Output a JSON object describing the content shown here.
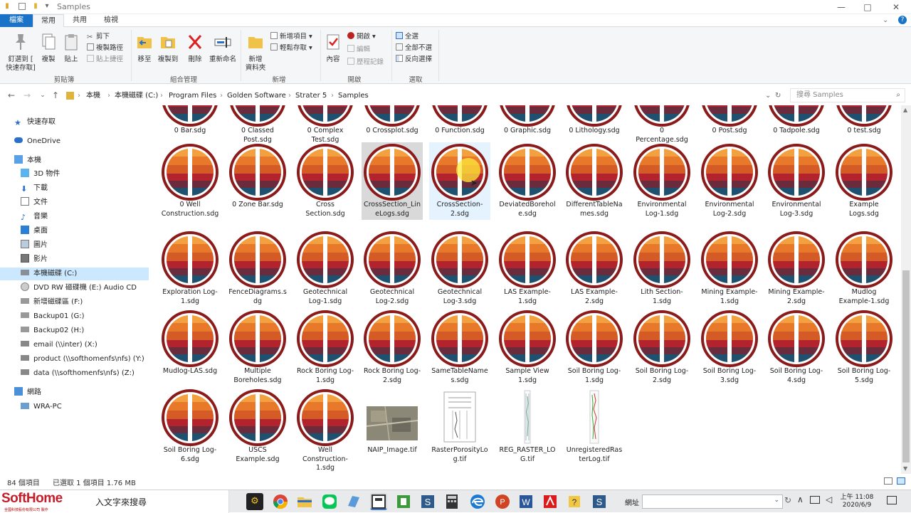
{
  "window": {
    "title": "Samples",
    "minimize": "—",
    "maximize": "□",
    "close": "✕"
  },
  "ribbon_tabs": {
    "file": "檔案",
    "home": "常用",
    "share": "共用",
    "view": "檢視"
  },
  "ribbon": {
    "pin": "釘選到 [​快速存取]",
    "pin_l1": "釘選到 [",
    "pin_l2": "快速存取]",
    "copy": "複製",
    "paste": "貼上",
    "cut": "剪下",
    "copy_path": "複製路徑",
    "paste_shortcut": "貼上捷徑",
    "clipboard_group": "剪貼簿",
    "move_to": "移至",
    "copy_to": "複製到",
    "delete": "刪除",
    "rename": "重新命名",
    "organize_group": "組合管理",
    "new_folder_l1": "新增",
    "new_folder_l2": "資料夾",
    "new_item": "新增項目 ▾",
    "easy_access": "輕鬆存取 ▾",
    "new_group": "新增",
    "properties": "內容",
    "open": "開啟 ▾",
    "edit": "編輯",
    "history": "歷程記錄",
    "open_group": "開啟",
    "select_all": "全選",
    "select_none": "全部不選",
    "invert_selection": "反向選擇",
    "select_group": "選取"
  },
  "address": {
    "crumbs": [
      "本機",
      "本機磁碟 (C:)",
      "Program Files",
      "Golden Software",
      "Strater 5",
      "Samples"
    ],
    "search_placeholder": "搜尋 Samples"
  },
  "nav": {
    "quick_access": "快速存取",
    "onedrive": "OneDrive",
    "this_pc": "本機",
    "objects3d": "3D 物件",
    "downloads": "下載",
    "documents": "文件",
    "music": "音樂",
    "desktop": "桌面",
    "pictures": "圖片",
    "videos": "影片",
    "local_c": "本機磁碟 (C:)",
    "dvd": "DVD RW 磁碟機 (E:) Audio CD",
    "new_vol_f": "新增磁碟區 (F:)",
    "backup01": "Backup01 (G:)",
    "backup02": "Backup02 (H:)",
    "email": "email (\\\\inter) (X:)",
    "product": "product (\\\\softhomenfs\\nfs) (Y:)",
    "data": "data (\\\\softhomenfs\\nfs) (Z:)",
    "network": "網路",
    "wra_pc": "WRA-PC"
  },
  "files": {
    "row0": [
      "0 Bar.sdg",
      "0 Classed Post.sdg",
      "0 Complex Test.sdg",
      "0 Crossplot.sdg",
      "0 Function.sdg",
      "0 Graphic.sdg",
      "0 Lithology.sdg",
      "0 Percentage.sdg",
      "0 Post.sdg",
      "0 Tadpole.sdg",
      "0 test.sdg"
    ],
    "row1": [
      "0 Well Construction.sdg",
      "0 Zone Bar.sdg",
      "Cross Section.sdg",
      "CrossSection_LineLogs.sdg",
      "CrossSection-2.sdg",
      "DeviatedBorehole.sdg",
      "DifferentTableNames.sdg",
      "Environmental Log-1.sdg",
      "Environmental Log-2.sdg",
      "Environmental Log-3.sdg",
      "Example Logs.sdg"
    ],
    "row2": [
      "Exploration Log-1.sdg",
      "FenceDiagrams.sdg",
      "Geotechnical Log-1.sdg",
      "Geotechnical Log-2.sdg",
      "Geotechnical Log-3.sdg",
      "LAS Example-1.sdg",
      "LAS Example-2.sdg",
      "Lith Section-1.sdg",
      "Mining Example-1.sdg",
      "Mining Example-2.sdg",
      "Mudlog Example-1.sdg"
    ],
    "row3": [
      "Mudlog-LAS.sdg",
      "Multiple Boreholes.sdg",
      "Rock Boring Log-1.sdg",
      "Rock Boring Log-2.sdg",
      "SameTableNames.sdg",
      "Sample View 1.sdg",
      "Soil Boring Log-1.sdg",
      "Soil Boring Log-2.sdg",
      "Soil Boring Log-3.sdg",
      "Soil Boring Log-4.sdg",
      "Soil Boring Log-5.sdg"
    ],
    "row4": [
      "Soil Boring Log-6.sdg",
      "USCS Example.sdg",
      "Well Construction-1.sdg",
      "NAIP_Image.tif",
      "RasterPorosityLog.tif",
      "REG_RASTER_LOG.tif",
      "UnregisteredRasterLog.tif"
    ]
  },
  "status": {
    "count": "84 個項目",
    "selected": "已選取 1 個項目  1.76 MB"
  },
  "taskbar": {
    "brand": "SoftHome",
    "brand_sub": "全國科技股份有限公司 製作",
    "search_text": "入文字來搜尋",
    "address_label": "網址",
    "time": "上午 11:08",
    "date": "2020/6/9"
  },
  "colors": {
    "accent": "#1a73c6",
    "selected_bg": "#cce8ff",
    "logo_ring": "#8b1a1a"
  }
}
